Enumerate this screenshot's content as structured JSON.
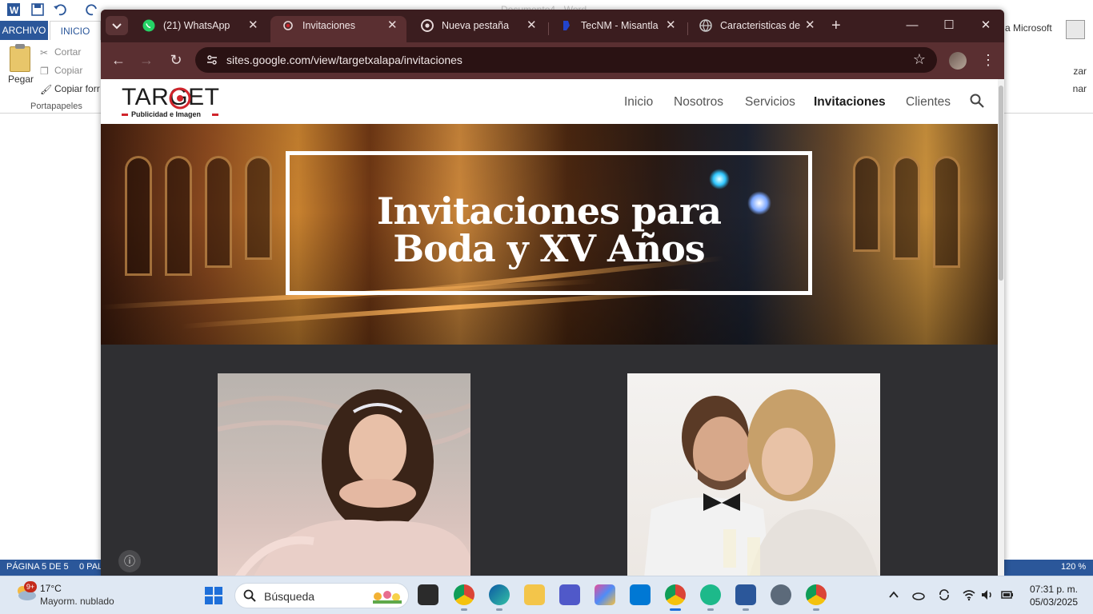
{
  "word": {
    "title": "Documento4 - Word",
    "tab_file": "ARCHIVO",
    "tab_home": "INICIO",
    "paste": "Pegar",
    "cut": "Cortar",
    "copy": "Copiar",
    "copy_format": "Copiar forr",
    "group_clipboard": "Portapapeles",
    "account": "a Microsoft",
    "ribbon_right_1": "zar",
    "ribbon_right_2": "nar",
    "status_page": "PÁGINA 5 DE 5",
    "status_words": "0 PAL",
    "zoom": "120 %"
  },
  "browser": {
    "tabs": [
      {
        "label": "(21) WhatsApp",
        "icon": "whatsapp-icon",
        "color": "#25d366"
      },
      {
        "label": "Invitaciones",
        "icon": "google-sites-icon",
        "color": "#e8dada"
      },
      {
        "label": "Nueva pestaña",
        "icon": "chrome-icon",
        "color": "#e8dada"
      },
      {
        "label": "TecNM - Misantla",
        "icon": "tecnm-icon",
        "color": "#2244cc"
      },
      {
        "label": "Caracteristicas de p",
        "icon": "globe-icon",
        "color": "#c8c8c8"
      }
    ],
    "url": "sites.google.com/view/targetxalapa/invitaciones",
    "theme_color": "#3b1d1f"
  },
  "site": {
    "logo": "TARGET",
    "logo_sub": "Publicidad e Imagen",
    "nav": [
      {
        "label": "Inicio"
      },
      {
        "label": "Nosotros"
      },
      {
        "label": "Servicios"
      },
      {
        "label": "Invitaciones"
      },
      {
        "label": "Clientes"
      }
    ],
    "hero_line1": "Invitaciones para",
    "hero_line2": "Boda y XV Años",
    "accent": "#d0242b"
  },
  "taskbar": {
    "weather_badge": "9+",
    "temperature": "17°C",
    "weather": "Mayorm. nublado",
    "search_placeholder": "Búsqueda",
    "time": "07:31 p. m.",
    "date": "05/03/2025"
  }
}
